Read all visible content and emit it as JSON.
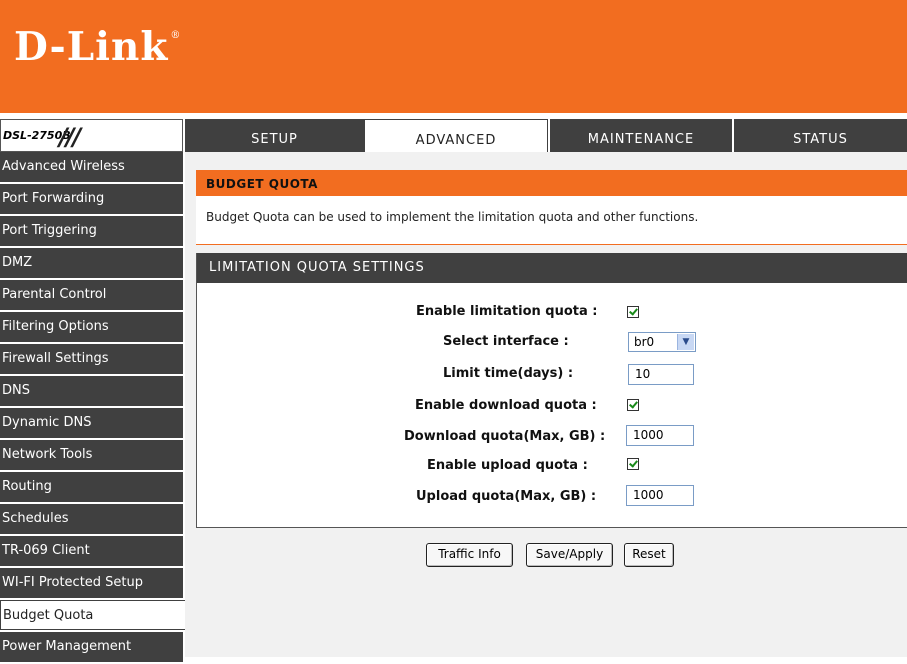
{
  "header": {
    "logo": "D-Link",
    "registered": "®"
  },
  "model": {
    "name": "DSL-2750B",
    "slashes": "///"
  },
  "tabs": [
    {
      "label": "SETUP",
      "active": false
    },
    {
      "label": "ADVANCED",
      "active": true
    },
    {
      "label": "MAINTENANCE",
      "active": false
    },
    {
      "label": "STATUS",
      "active": false
    }
  ],
  "sidebar": {
    "items": [
      {
        "label": "Advanced Wireless"
      },
      {
        "label": "Port Forwarding"
      },
      {
        "label": "Port Triggering"
      },
      {
        "label": "DMZ"
      },
      {
        "label": "Parental Control"
      },
      {
        "label": "Filtering Options"
      },
      {
        "label": "Firewall Settings"
      },
      {
        "label": "DNS"
      },
      {
        "label": "Dynamic DNS"
      },
      {
        "label": "Network Tools"
      },
      {
        "label": "Routing"
      },
      {
        "label": "Schedules"
      },
      {
        "label": "TR-069 Client"
      },
      {
        "label": "WI-FI Protected Setup"
      },
      {
        "label": "Budget Quota",
        "active": true
      },
      {
        "label": "Power Management"
      }
    ]
  },
  "budget_quota": {
    "title": "BUDGET QUOTA",
    "description": "Budget Quota can be used to implement the limitation quota and other functions."
  },
  "limitation": {
    "title": "LIMITATION QUOTA SETTINGS",
    "enable_limitation_label": "Enable limitation quota :",
    "enable_limitation_checked": true,
    "select_interface_label": "Select interface :",
    "select_interface_value": "br0",
    "limit_time_label": "Limit time(days) :",
    "limit_time_value": "10",
    "enable_download_label": "Enable download quota :",
    "enable_download_checked": true,
    "download_quota_label": "Download quota(Max, GB) :",
    "download_quota_value": "1000",
    "enable_upload_label": "Enable upload quota :",
    "enable_upload_checked": true,
    "upload_quota_label": "Upload quota(Max, GB) :",
    "upload_quota_value": "1000"
  },
  "buttons": {
    "traffic_info": "Traffic Info",
    "save_apply": "Save/Apply",
    "reset": "Reset"
  },
  "colors": {
    "brand_orange": "#f26d20",
    "dark_gray": "#404040"
  }
}
